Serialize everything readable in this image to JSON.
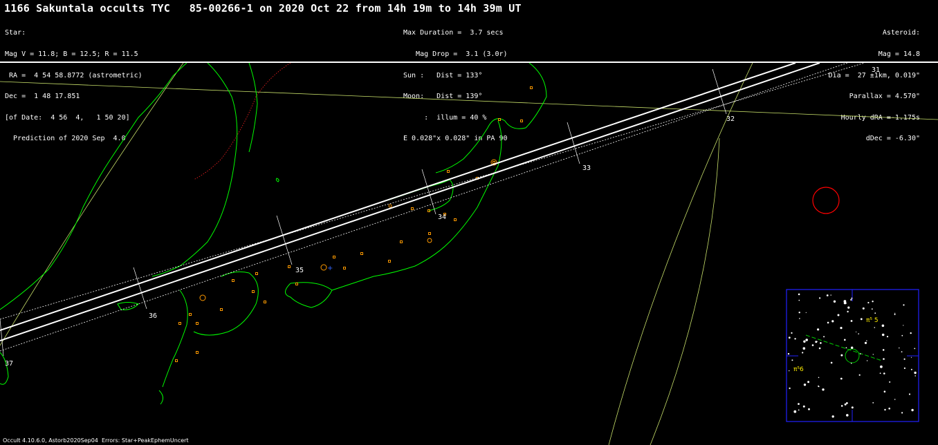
{
  "header": {
    "title": "1166 Sakuntala occults TYC   85-00266-1 on 2020 Oct 22 from 14h 19m to 14h 39m UT",
    "star_block": [
      "Star:",
      "Mag V = 11.8; B = 12.5; R = 11.5",
      " RA =  4 54 58.8772 (astrometric)",
      "Dec =  1 48 17.851",
      "[of Date:  4 56  4,   1 50 20]",
      "  Prediction of 2020 Sep  4.0"
    ],
    "event_block": [
      "Max Duration =  3.7 secs",
      "   Mag Drop =  3.1 (3.0r)",
      "Sun :   Dist = 133°",
      "Moon:   Dist = 139°",
      "     :  illum = 40 %",
      "E 0.028\"x 0.028\" in PA 90"
    ],
    "asteroid_block": [
      "Asteroid:",
      "Mag = 14.8",
      "Dia =  27 ±1km, 0.019\"",
      "Parallax = 4.570\"",
      "Hourly dRA =-1.175s",
      "dDec = -6.30\""
    ]
  },
  "minute_labels": [
    "31",
    "32",
    "33",
    "34",
    "35",
    "36",
    "37"
  ],
  "finder": {
    "star_label_1": "π⁵ 5",
    "star_label_2": "π⁵6"
  },
  "footer": "Occult 4.10.6.0, Astorb2020Sep04  Errors: Star+PeakEphemUncert",
  "colors": {
    "background": "#000000",
    "coast": "#00ff00",
    "path": "#ffffff",
    "cities": "#ff9900",
    "border": "#ff2222",
    "meridian": "#c8e06a",
    "finder_frame": "#0000ff",
    "sun_moon_circle": "#ff0000"
  }
}
